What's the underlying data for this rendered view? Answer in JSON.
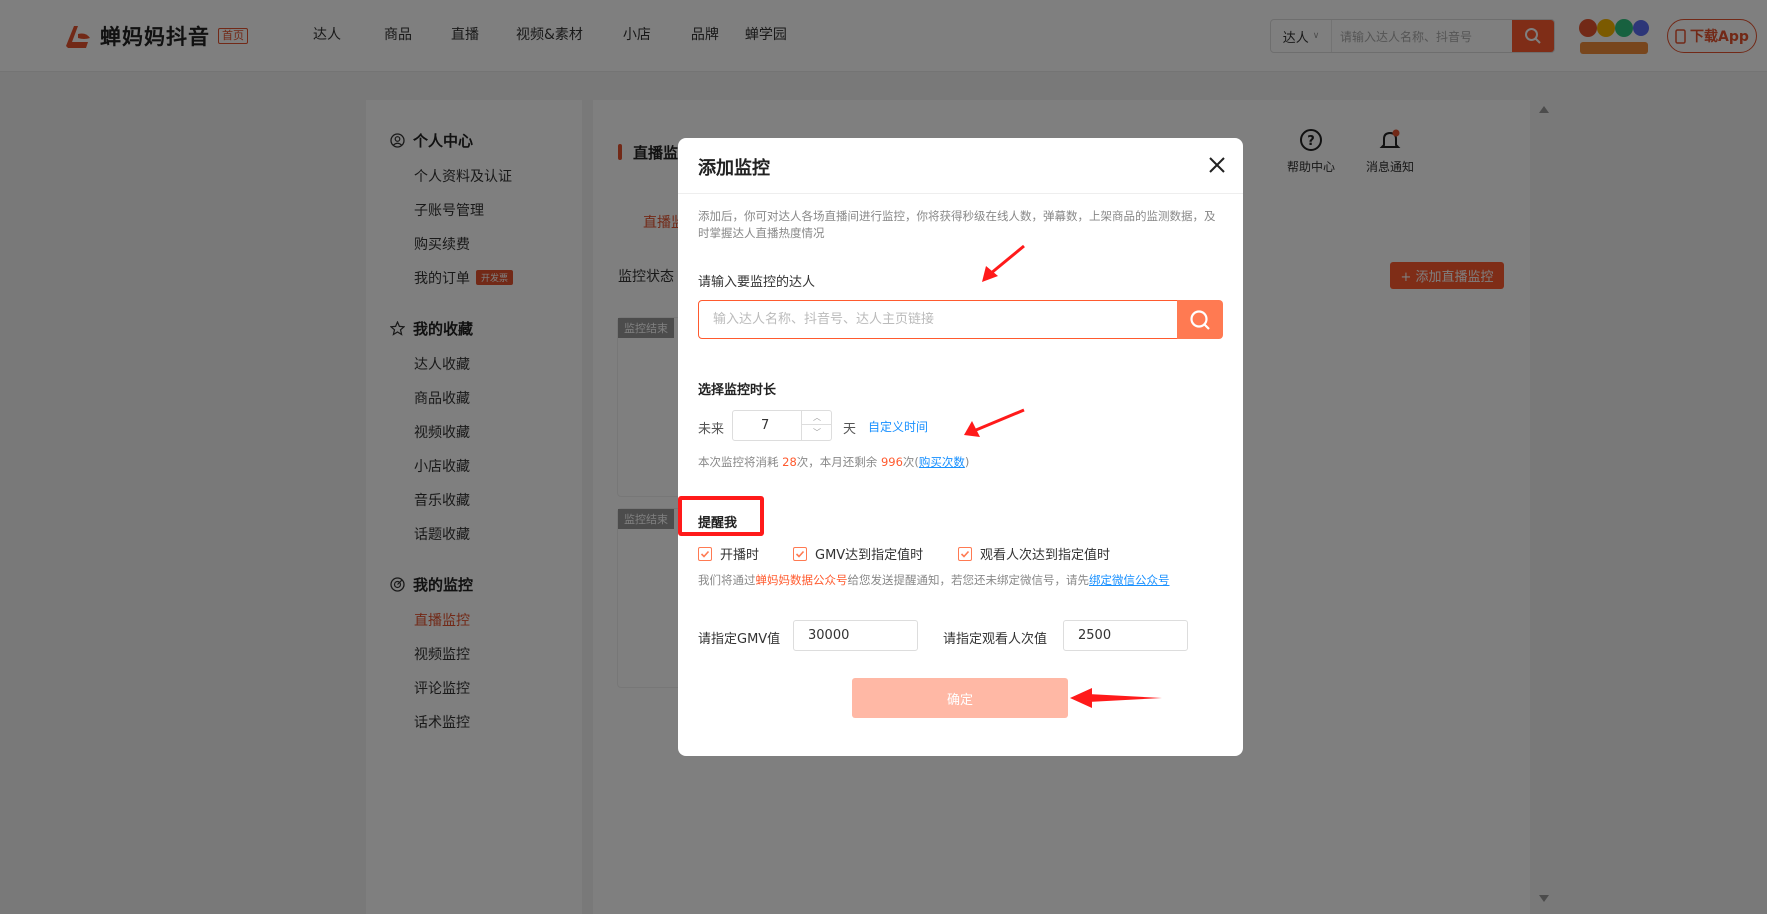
{
  "brand": {
    "name": "蝉妈妈抖音",
    "badge": "首页"
  },
  "nav": [
    "达人",
    "商品",
    "直播",
    "视频&素材",
    "小店",
    "品牌",
    "蝉学园"
  ],
  "search": {
    "type": "达人",
    "placeholder": "请输入达人名称、抖音号"
  },
  "download_label": "下载App",
  "sidebar": {
    "groups": [
      {
        "title": "个人中心",
        "items": [
          "个人资料及认证",
          "子账号管理",
          "购买续费",
          "我的订单"
        ]
      },
      {
        "title": "我的收藏",
        "items": [
          "达人收藏",
          "商品收藏",
          "视频收藏",
          "小店收藏",
          "音乐收藏",
          "话题收藏"
        ]
      },
      {
        "title": "我的监控",
        "items": [
          "直播监控",
          "视频监控",
          "评论监控",
          "话术监控"
        ]
      }
    ],
    "order_tag": "开发票"
  },
  "main": {
    "title": "直播监",
    "tab": "直播监",
    "filter_label": "监控状态",
    "add_button": "+ 添加直播监控",
    "help": "帮助中心",
    "notify": "消息通知",
    "card_status": "监控结束"
  },
  "modal": {
    "title": "添加监控",
    "desc": "添加后，你可对达人各场直播间进行监控，你将获得秒级在线人数，弹幕数，上架商品的监测数据，及时掌握达人直播热度情况",
    "target_label": "请输入要监控的达人",
    "target_placeholder": "输入达人名称、抖音号、达人主页链接",
    "duration_label": "选择监控时长",
    "future": "未来",
    "days_value": "7",
    "day_unit": "天",
    "custom_time": "自定义时间",
    "cost_prefix": "本次监控将消耗 ",
    "cost_value": "28",
    "cost_mid": "次，本月还剩余 ",
    "remain_value": "996",
    "cost_suffix": "次(",
    "buy_link": "购买次数",
    "cost_close": ")",
    "remind_label": "提醒我",
    "checks": [
      "开播时",
      "GMV达到指定值时",
      "观看人次达到指定值时"
    ],
    "notice_prefix": "我们将通过",
    "notice_account": "蝉妈妈数据公众号",
    "notice_mid": "给您发送提醒通知，若您还未绑定微信号，请先",
    "notice_link": "绑定微信公众号",
    "gmv_label": "请指定GMV值",
    "gmv_value": "30000",
    "views_label": "请指定观看人次值",
    "views_value": "2500",
    "confirm": "确定"
  },
  "colors": {
    "accent": "#ff5a2e",
    "link": "#1890ff",
    "annotation": "#ff1a1a"
  }
}
